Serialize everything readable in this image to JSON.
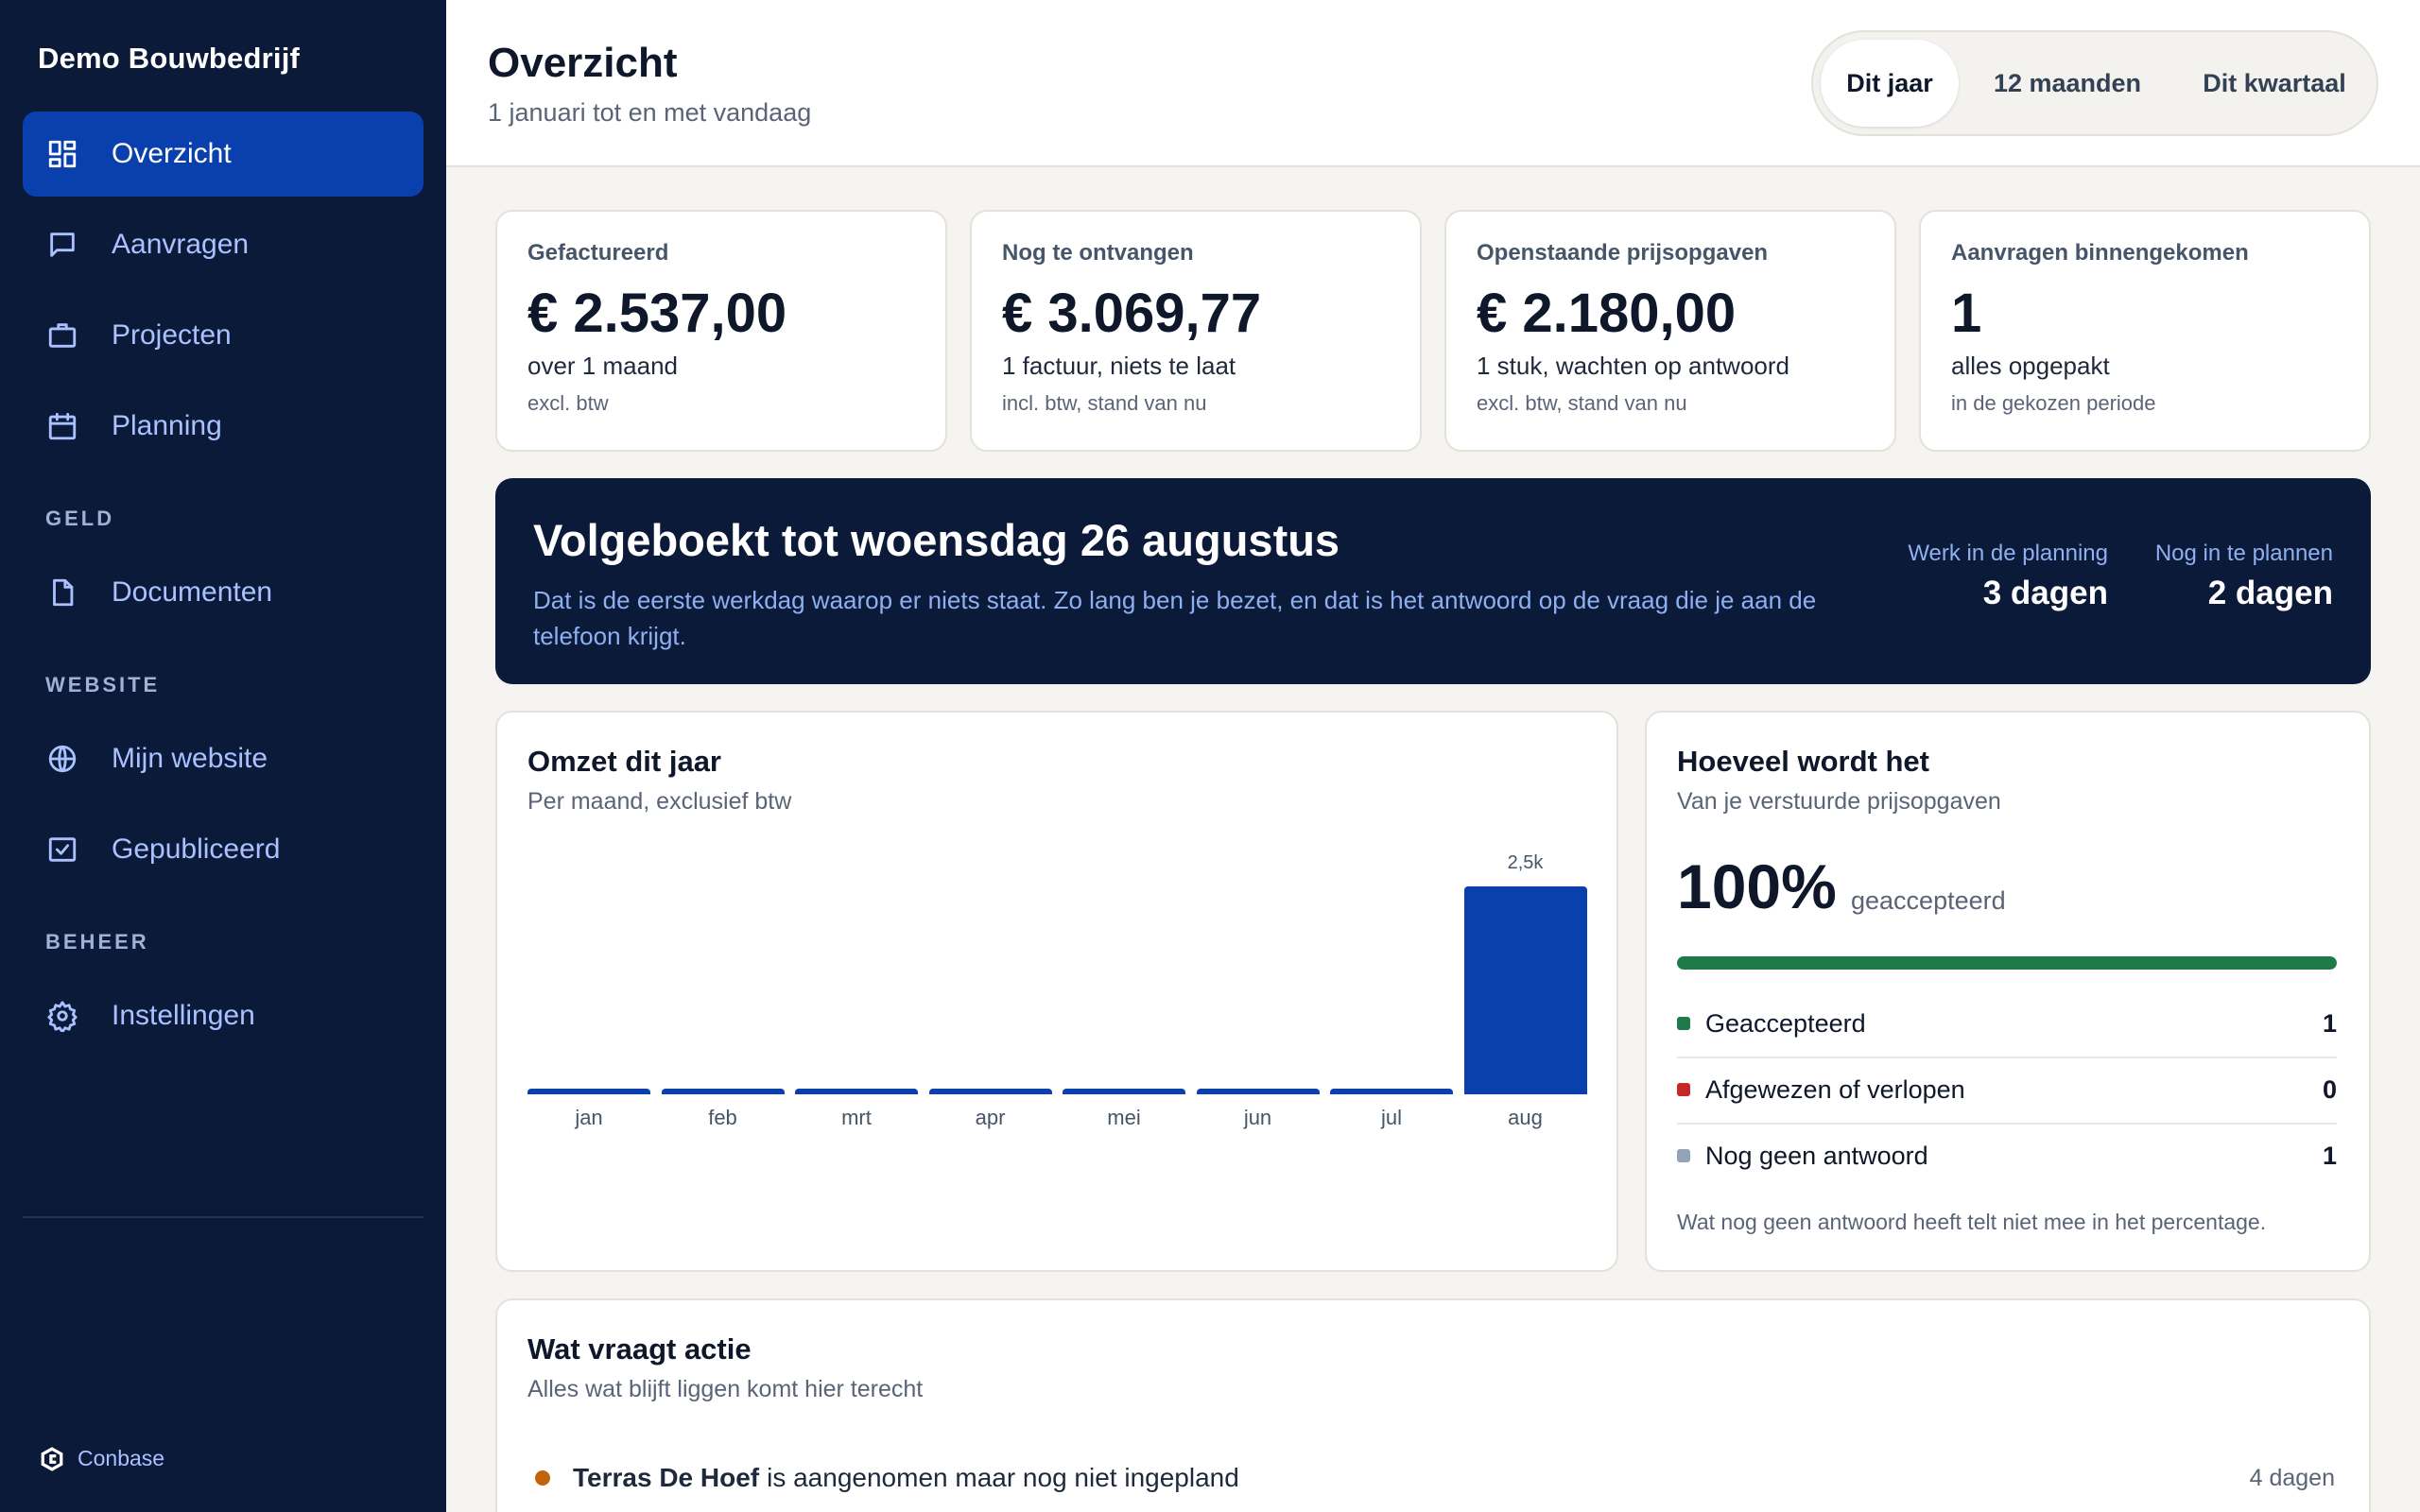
{
  "app": {
    "company": "Demo Bouwbedrijf",
    "footer_brand": "Conbase"
  },
  "sidebar": {
    "items": [
      {
        "label": "Overzicht",
        "icon": "dashboard-icon",
        "active": true
      },
      {
        "label": "Aanvragen",
        "icon": "message-icon"
      },
      {
        "label": "Projecten",
        "icon": "briefcase-icon"
      },
      {
        "label": "Planning",
        "icon": "calendar-icon"
      }
    ],
    "sections": [
      {
        "label": "GELD",
        "items": [
          {
            "label": "Documenten",
            "icon": "document-icon"
          }
        ]
      },
      {
        "label": "WEBSITE",
        "items": [
          {
            "label": "Mijn website",
            "icon": "globe-icon"
          },
          {
            "label": "Gepubliceerd",
            "icon": "published-icon"
          }
        ]
      },
      {
        "label": "BEHEER",
        "items": [
          {
            "label": "Instellingen",
            "icon": "gear-icon"
          }
        ]
      }
    ]
  },
  "header": {
    "title": "Overzicht",
    "subtitle": "1 januari tot en met vandaag",
    "periods": [
      "Dit jaar",
      "12 maanden",
      "Dit kwartaal"
    ],
    "active_period": "Dit jaar"
  },
  "stats": [
    {
      "label": "Gefactureerd",
      "value": "€ 2.537,00",
      "sub": "over 1 maand",
      "note": "excl. btw"
    },
    {
      "label": "Nog te ontvangen",
      "value": "€ 3.069,77",
      "sub": "1 factuur, niets te laat",
      "note": "incl. btw, stand van nu"
    },
    {
      "label": "Openstaande prijsopgaven",
      "value": "€ 2.180,00",
      "sub": "1 stuk, wachten op antwoord",
      "note": "excl. btw, stand van nu"
    },
    {
      "label": "Aanvragen binnengekomen",
      "value": "1",
      "sub": "alles opgepakt",
      "note": "in de gekozen periode"
    }
  ],
  "banner": {
    "title": "Volgeboekt tot woensdag 26 augustus",
    "text": "Dat is de eerste werkdag waarop er niets staat. Zo lang ben je bezet, en dat is het antwoord op de vraag die je aan de telefoon krijgt.",
    "stats": [
      {
        "label": "Werk in de planning",
        "value": "3 dagen"
      },
      {
        "label": "Nog in te plannen",
        "value": "2 dagen"
      }
    ]
  },
  "revenue": {
    "title": "Omzet dit jaar",
    "subtitle": "Per maand, exclusief btw",
    "value_label": "2,5k"
  },
  "chart_data": {
    "type": "bar",
    "title": "Omzet dit jaar",
    "subtitle": "Per maand, exclusief btw",
    "categories": [
      "jan",
      "feb",
      "mrt",
      "apr",
      "mei",
      "jun",
      "jul",
      "aug"
    ],
    "values": [
      0,
      0,
      0,
      0,
      0,
      0,
      0,
      2537
    ],
    "data_labels": [
      "",
      "",
      "",
      "",
      "",
      "",
      "",
      "2,5k"
    ],
    "ylim": [
      0,
      2537
    ],
    "grid": false,
    "color": "#0a3fae"
  },
  "quotes": {
    "title": "Hoeveel wordt het",
    "subtitle": "Van je verstuurde prijsopgaven",
    "percentage": "100%",
    "percentage_label": "geaccepteerd",
    "progress_fraction": 1.0,
    "rows": [
      {
        "label": "Geaccepteerd",
        "value": "1",
        "color": "#1f7a4a"
      },
      {
        "label": "Afgewezen of verlopen",
        "value": "0",
        "color": "#c62828"
      },
      {
        "label": "Nog geen antwoord",
        "value": "1",
        "color": "#94a3b8"
      }
    ],
    "note": "Wat nog geen antwoord heeft telt niet mee in het percentage."
  },
  "actions": {
    "title": "Wat vraagt actie",
    "subtitle": "Alles wat blijft liggen komt hier terecht",
    "items": [
      {
        "name": "Terras De Hoef",
        "text": "is aangenomen maar nog niet ingepland",
        "time": "4 dagen"
      }
    ]
  },
  "colors": {
    "sidebar_bg": "#0c1a3a",
    "accent": "#0a3fae",
    "success": "#1f7a4a",
    "danger": "#c62828",
    "warning": "#c2620c"
  }
}
